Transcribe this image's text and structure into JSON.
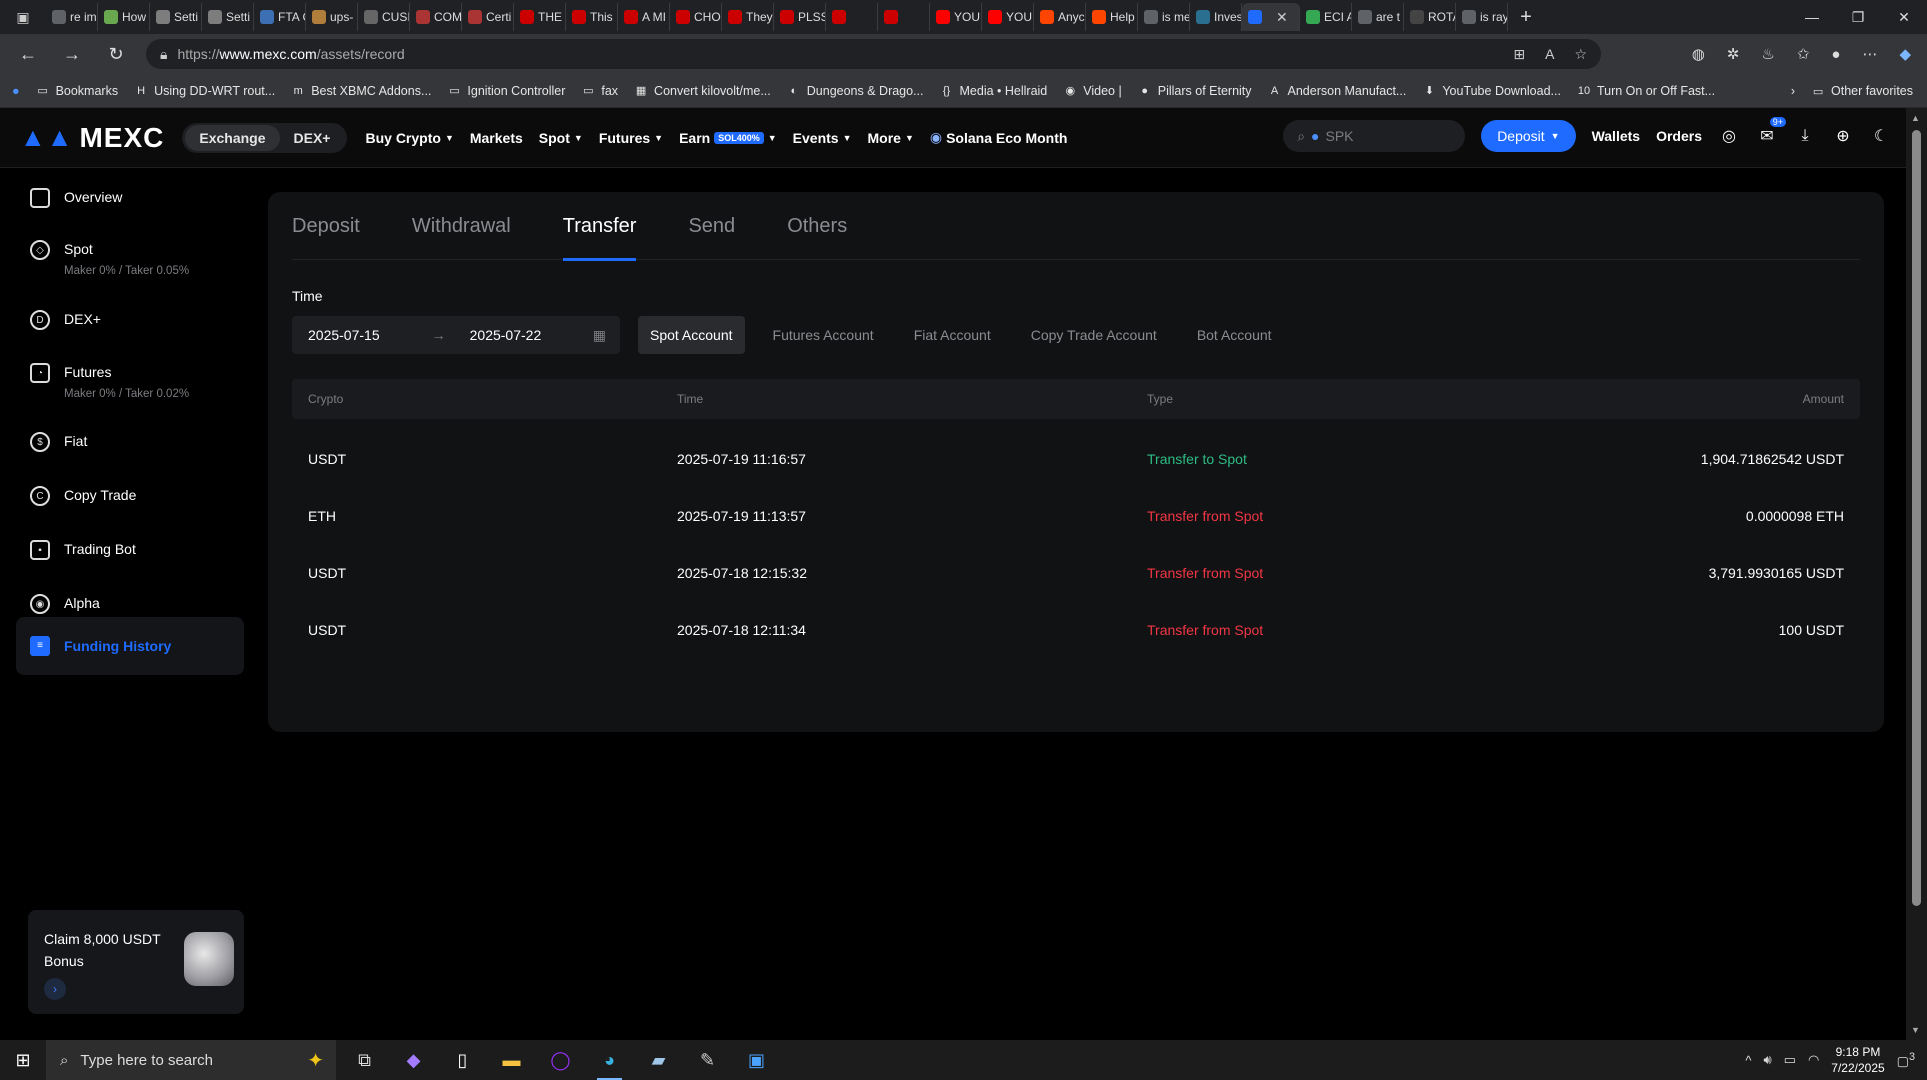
{
  "browser": {
    "tabs": [
      {
        "label": "re im",
        "color": "#5f6368"
      },
      {
        "label": "How",
        "color": "#6aa84f"
      },
      {
        "label": "Setti",
        "color": "#7d7d7d"
      },
      {
        "label": "Setti",
        "color": "#7d7d7d"
      },
      {
        "label": "FTA C",
        "color": "#3d6fb4"
      },
      {
        "label": "ups-",
        "color": "#b07d3a"
      },
      {
        "label": "CUSI",
        "color": "#666666"
      },
      {
        "label": "COM",
        "color": "#a33"
      },
      {
        "label": "Certi",
        "color": "#a33"
      },
      {
        "label": "THE",
        "color": "#c00"
      },
      {
        "label": "This",
        "color": "#c00"
      },
      {
        "label": "A MI",
        "color": "#c00"
      },
      {
        "label": "CHO",
        "color": "#c00"
      },
      {
        "label": "They",
        "color": "#c00"
      },
      {
        "label": "PLSS",
        "color": "#c00"
      },
      {
        "label": "",
        "color": "#c00"
      },
      {
        "label": "",
        "color": "#c00"
      },
      {
        "label": "YOU",
        "color": "#f00"
      },
      {
        "label": "YOU",
        "color": "#f00"
      },
      {
        "label": "Anyc",
        "color": "#ff4500"
      },
      {
        "label": "Help",
        "color": "#ff4500"
      },
      {
        "label": "is me",
        "color": "#5f6368"
      },
      {
        "label": "Inves",
        "color": "#2a6f8f"
      },
      {
        "label": "",
        "color": "#1f6bff"
      },
      {
        "label": "ECI A",
        "color": "#34a853"
      },
      {
        "label": "are t",
        "color": "#5f6368"
      },
      {
        "label": "ROTA",
        "color": "#444"
      },
      {
        "label": "is ray",
        "color": "#5f6368"
      }
    ],
    "url_prefix": "https://",
    "url_host": "www.mexc.com",
    "url_path": "/assets/record",
    "bookmarks": [
      {
        "label": "Bookmarks",
        "icon": "folder-icon"
      },
      {
        "label": "Using DD-WRT rout...",
        "icon": "h-icon"
      },
      {
        "label": "Best XBMC Addons...",
        "icon": "m-icon"
      },
      {
        "label": "Ignition Controller",
        "icon": "folder-icon"
      },
      {
        "label": "fax",
        "icon": "folder-icon"
      },
      {
        "label": "Convert kilovolt/me...",
        "icon": "grid-icon"
      },
      {
        "label": "Dungeons & Drago...",
        "icon": "d-icon"
      },
      {
        "label": "Media • Hellraid",
        "icon": "brace-icon"
      },
      {
        "label": "Video |",
        "icon": "film-icon"
      },
      {
        "label": "Pillars of Eternity",
        "icon": "circle-icon"
      },
      {
        "label": "Anderson Manufact...",
        "icon": "a-icon"
      },
      {
        "label": "YouTube Download...",
        "icon": "download-icon"
      },
      {
        "label": "Turn On or Off Fast...",
        "icon": "ten-icon"
      }
    ],
    "other_favorites": "Other favorites"
  },
  "header": {
    "logo": "MEXC",
    "switch": [
      "Exchange",
      "DEX+"
    ],
    "nav": [
      "Buy Crypto",
      "Markets",
      "Spot",
      "Futures",
      "Earn",
      "Events",
      "More"
    ],
    "earn_badge": "SOL400%",
    "promo_link": "Solana Eco Month",
    "search_placeholder": "SPK",
    "deposit": "Deposit",
    "wallets": "Wallets",
    "orders": "Orders",
    "notif_count": "9+"
  },
  "sidebar": {
    "items": [
      {
        "label": "Overview",
        "sub": ""
      },
      {
        "label": "Spot",
        "sub": "Maker 0% / Taker 0.05%"
      },
      {
        "label": "DEX+",
        "sub": ""
      },
      {
        "label": "Futures",
        "sub": "Maker 0% / Taker 0.02%"
      },
      {
        "label": "Fiat",
        "sub": ""
      },
      {
        "label": "Copy Trade",
        "sub": ""
      },
      {
        "label": "Trading Bot",
        "sub": ""
      },
      {
        "label": "Alpha",
        "sub": ""
      },
      {
        "label": "Funding History",
        "sub": ""
      }
    ],
    "promo": "Claim 8,000 USDT Bonus"
  },
  "main": {
    "tabs": [
      "Deposit",
      "Withdrawal",
      "Transfer",
      "Send",
      "Others"
    ],
    "active_tab": "Transfer",
    "time_label": "Time",
    "date_from": "2025-07-15",
    "date_to": "2025-07-22",
    "accounts": [
      "Spot Account",
      "Futures Account",
      "Fiat Account",
      "Copy Trade Account",
      "Bot Account"
    ],
    "columns": [
      "Crypto",
      "Time",
      "Type",
      "Amount"
    ],
    "rows": [
      {
        "crypto": "USDT",
        "time": "2025-07-19 11:16:57",
        "type": "Transfer to Spot",
        "direction": "in",
        "amount": "1,904.71862542 USDT"
      },
      {
        "crypto": "ETH",
        "time": "2025-07-19 11:13:57",
        "type": "Transfer from Spot",
        "direction": "out",
        "amount": "0.0000098 ETH"
      },
      {
        "crypto": "USDT",
        "time": "2025-07-18 12:15:32",
        "type": "Transfer from Spot",
        "direction": "out",
        "amount": "3,791.9930165 USDT"
      },
      {
        "crypto": "USDT",
        "time": "2025-07-18 12:11:34",
        "type": "Transfer from Spot",
        "direction": "out",
        "amount": "100 USDT"
      }
    ]
  },
  "taskbar": {
    "search_placeholder": "Type here to search",
    "time": "9:18 PM",
    "date": "7/22/2025",
    "notif_count": "3"
  }
}
